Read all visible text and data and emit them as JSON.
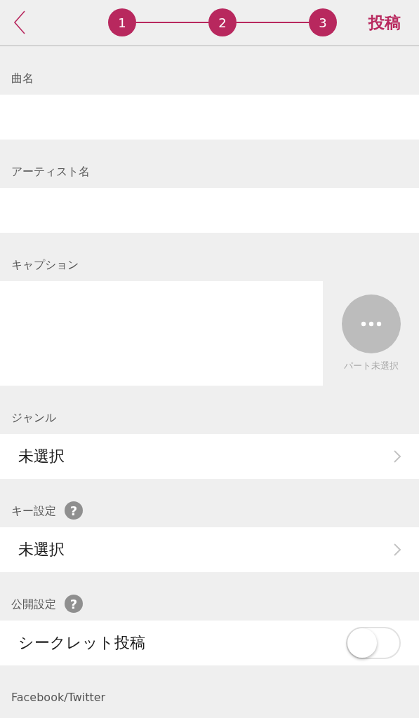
{
  "header": {
    "steps": [
      {
        "label": "1"
      },
      {
        "label": "2"
      },
      {
        "label": "3"
      }
    ],
    "submit": "投稿"
  },
  "sections": [
    {
      "kind": "text_field",
      "label": "曲名"
    },
    {
      "kind": "text_field",
      "label": "アーティスト名"
    },
    {
      "kind": "caption",
      "label": "キャプション",
      "part_button": "パート未選択"
    },
    {
      "kind": "select",
      "label": "ジャンル",
      "value": "未選択"
    },
    {
      "kind": "select",
      "label": "キー設定",
      "help": "?",
      "value": "未選択"
    },
    {
      "kind": "toggle",
      "label": "公開設定",
      "help": "?",
      "value": "シークレット投稿",
      "on": false
    },
    {
      "kind": "heading",
      "label": "Facebook/Twitter"
    }
  ]
}
